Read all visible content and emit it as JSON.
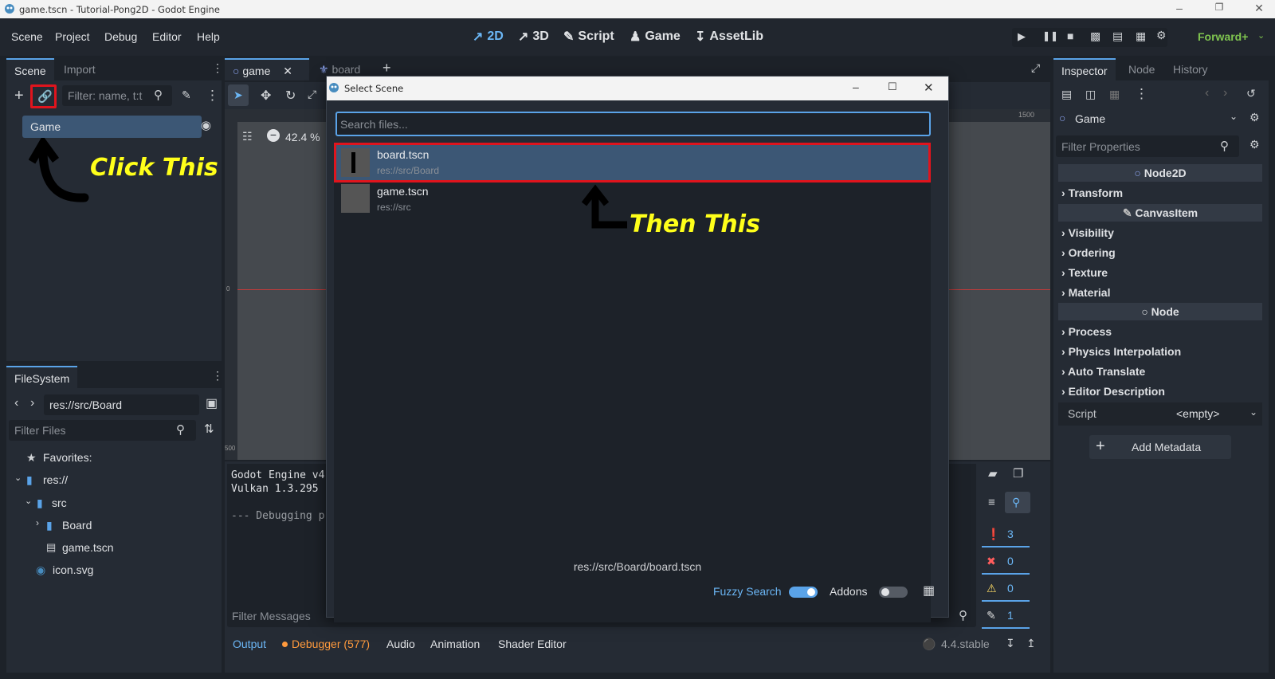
{
  "window": {
    "title": "game.tscn - Tutorial-Pong2D - Godot Engine"
  },
  "menu": [
    "Scene",
    "Project",
    "Debug",
    "Editor",
    "Help"
  ],
  "workspaces": [
    "2D",
    "3D",
    "Script",
    "Game",
    "AssetLib"
  ],
  "renderer": "Forward+",
  "scene_dock": {
    "tabs": [
      "Scene",
      "Import"
    ],
    "filter_placeholder": "Filter: name, t:t",
    "root_node": "Game"
  },
  "filesystem": {
    "tab": "FileSystem",
    "path": "res://src/Board",
    "filter_placeholder": "Filter Files",
    "favorites": "Favorites:",
    "tree": [
      "res://",
      "src",
      "Board",
      "game.tscn",
      "icon.svg"
    ]
  },
  "editor_tabs": [
    "game",
    "board"
  ],
  "viewport": {
    "zoom": "42.4 %",
    "ruler_top": "1500",
    "ruler_left_0": "0",
    "ruler_left_500": "500"
  },
  "output": {
    "lines": [
      "Godot Engine v4",
      "Vulkan 1.3.295 -",
      "",
      "--- Debugging pr"
    ],
    "filter_placeholder": "Filter Messages",
    "tabs": [
      "Output",
      "Debugger (577)",
      "Audio",
      "Animation",
      "Shader Editor"
    ],
    "version": "4.4.stable",
    "counts": [
      "3",
      "0",
      "0",
      "1"
    ]
  },
  "dialog": {
    "title": "Select Scene",
    "search_placeholder": "Search files...",
    "items": [
      {
        "name": "board.tscn",
        "path": "res://src/Board"
      },
      {
        "name": "game.tscn",
        "path": "res://src"
      }
    ],
    "selected_path": "res://src/Board/board.tscn",
    "fuzzy_label": "Fuzzy Search",
    "addons_label": "Addons"
  },
  "inspector": {
    "tabs": [
      "Inspector",
      "Node",
      "History"
    ],
    "object": "Game",
    "filter_placeholder": "Filter Properties",
    "headers": [
      "Node2D",
      "CanvasItem",
      "Node"
    ],
    "sections_node2d": [
      "Transform"
    ],
    "sections_canvas": [
      "Visibility",
      "Ordering",
      "Texture",
      "Material"
    ],
    "sections_node": [
      "Process",
      "Physics Interpolation",
      "Auto Translate",
      "Editor Description"
    ],
    "script_label": "Script",
    "script_value": "<empty>",
    "add_metadata": "Add Metadata"
  },
  "annotations": {
    "first": "Click This",
    "second": "Then This"
  },
  "colors": {
    "accent": "#5aa3e8",
    "highlight": "#e0141d",
    "annotation": "#ffff1a"
  }
}
